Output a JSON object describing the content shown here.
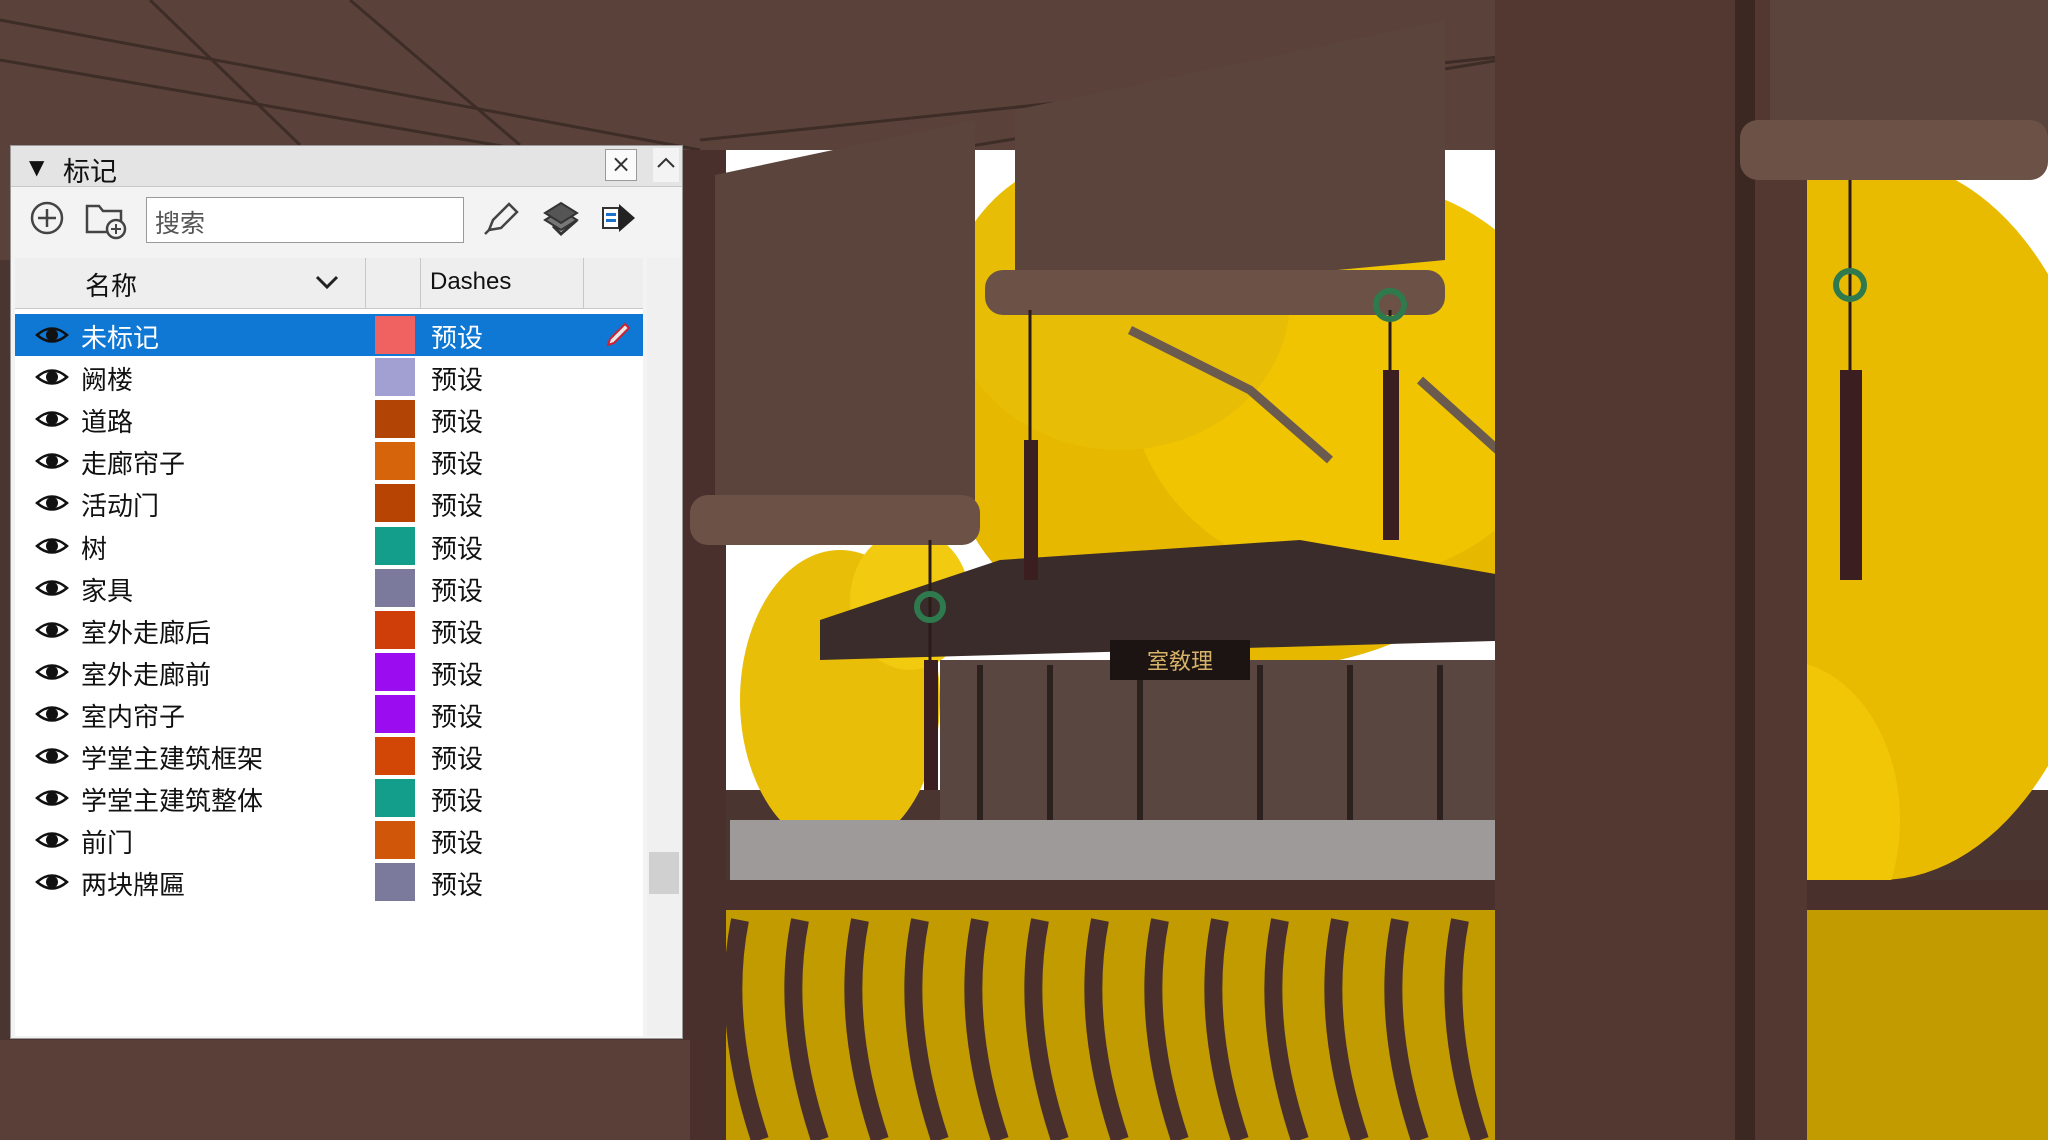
{
  "panel": {
    "title": "标记",
    "search_placeholder": "搜索",
    "columns": {
      "name": "名称",
      "dashes": "Dashes"
    },
    "close_label": "×"
  },
  "tags": [
    {
      "name": "未标记",
      "color": "#f06262",
      "dashes": "预设",
      "selected": true
    },
    {
      "name": "阙楼",
      "color": "#a29fd2",
      "dashes": "预设"
    },
    {
      "name": "道路",
      "color": "#b24506",
      "dashes": "预设"
    },
    {
      "name": "走廊帘子",
      "color": "#d5640b",
      "dashes": "预设"
    },
    {
      "name": "活动门",
      "color": "#b84404",
      "dashes": "预设"
    },
    {
      "name": "树",
      "color": "#139e8c",
      "dashes": "预设"
    },
    {
      "name": "家具",
      "color": "#7c7a9c",
      "dashes": "预设"
    },
    {
      "name": "室外走廊后",
      "color": "#cf3e08",
      "dashes": "预设"
    },
    {
      "name": "室外走廊前",
      "color": "#9c0cf0",
      "dashes": "预设"
    },
    {
      "name": "室内帘子",
      "color": "#9c0cf0",
      "dashes": "预设"
    },
    {
      "name": "学堂主建筑框架",
      "color": "#d24706",
      "dashes": "预设"
    },
    {
      "name": "学堂主建筑整体",
      "color": "#139e8c",
      "dashes": "预设"
    },
    {
      "name": "前门",
      "color": "#d0560a",
      "dashes": "预设"
    },
    {
      "name": "两块牌匾",
      "color": "#7c7a9c",
      "dashes": "预设"
    }
  ],
  "scene": {
    "plaque_text": "室敎理"
  }
}
